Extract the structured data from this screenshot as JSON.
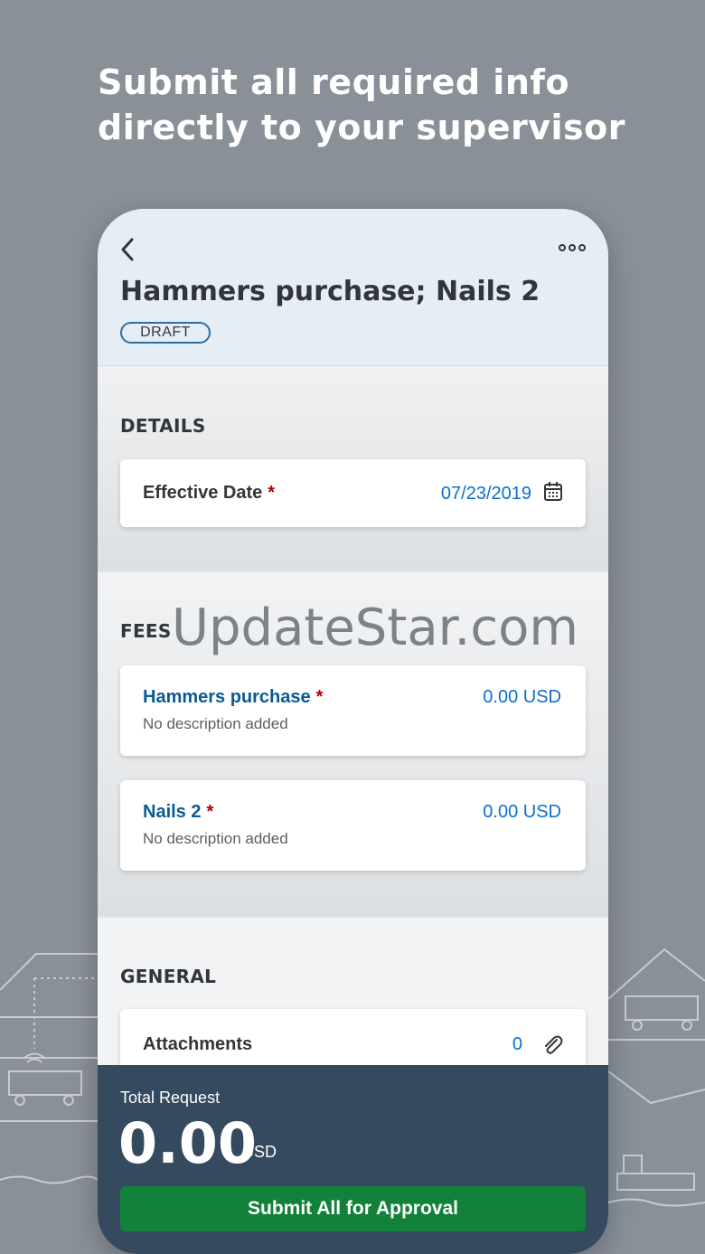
{
  "headline": {
    "line1": "Submit all required info",
    "line2": "directly to your supervisor"
  },
  "header": {
    "title": "Hammers purchase; Nails 2",
    "status": "DRAFT",
    "back_icon": "chevron-left-icon",
    "more_icon": "more-horizontal-icon"
  },
  "details": {
    "section_title": "DETAILS",
    "effective_date_label": "Effective Date",
    "required_marker": "*",
    "effective_date_value": "07/23/2019",
    "calendar_icon": "calendar-icon"
  },
  "fees": {
    "section_title": "FEES",
    "watermark": "UpdateStar.com",
    "items": [
      {
        "name": "Hammers purchase",
        "required": "*",
        "description": "No description added",
        "amount": "0.00 USD"
      },
      {
        "name": "Nails 2",
        "required": "*",
        "description": "No description added",
        "amount": "0.00 USD"
      }
    ]
  },
  "general": {
    "section_title": "GENERAL",
    "attachments_label": "Attachments",
    "attachments_count": "0",
    "attachment_icon": "paperclip-icon"
  },
  "footer": {
    "total_label": "Total Request",
    "total_value": "0.00",
    "currency": "USD",
    "submit_label": "Submit All for Approval"
  },
  "colors": {
    "background": "#8a9098",
    "header_bg": "#e6eef5",
    "footer_bg": "#354a5f",
    "submit_green": "#12823a",
    "link_blue": "#0a6ed1",
    "required_red": "#b00000"
  }
}
